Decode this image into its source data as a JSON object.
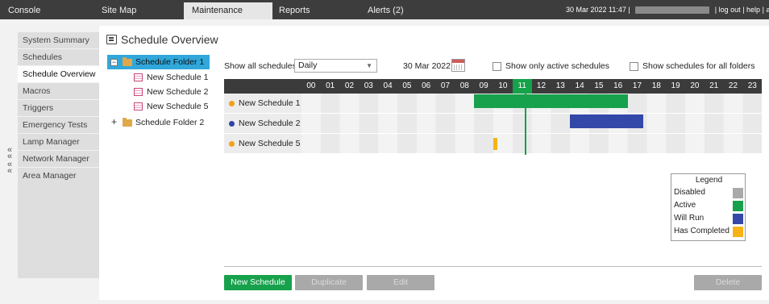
{
  "topbar": {
    "tabs": [
      {
        "label": "Console"
      },
      {
        "label": "Site Map"
      },
      {
        "label": "Maintenance"
      },
      {
        "label": "Reports"
      },
      {
        "label": "Alerts (2)"
      }
    ],
    "datetime": "30 Mar 2022 11:47",
    "links": {
      "logout": "log out",
      "help": "help",
      "about": "abou"
    },
    "sep": "|"
  },
  "sidebar": {
    "items": [
      {
        "label": "System Summary"
      },
      {
        "label": "Schedules"
      },
      {
        "label": "Schedule Overview"
      },
      {
        "label": "Macros"
      },
      {
        "label": "Triggers"
      },
      {
        "label": "Emergency Tests"
      },
      {
        "label": "Lamp Manager"
      },
      {
        "label": "Network Manager"
      },
      {
        "label": "Area Manager"
      }
    ],
    "collapse_glyph": "«"
  },
  "page": {
    "title": "Schedule Overview"
  },
  "tree": {
    "folder1": {
      "label": "Schedule Folder 1",
      "toggle": "−"
    },
    "schedules": [
      {
        "label": "New Schedule 1"
      },
      {
        "label": "New Schedule 2"
      },
      {
        "label": "New Schedule 5"
      }
    ],
    "folder2": {
      "label": "Schedule Folder 2",
      "toggle": "+"
    }
  },
  "controls": {
    "show_all_label": "Show all schedules",
    "period_value": "Daily",
    "date": "30 Mar 2022",
    "only_active_label": "Show only active schedules",
    "all_folders_label": "Show schedules for all folders"
  },
  "timeline": {
    "hours": [
      "00",
      "01",
      "02",
      "03",
      "04",
      "05",
      "06",
      "07",
      "08",
      "09",
      "10",
      "11",
      "12",
      "13",
      "14",
      "15",
      "16",
      "17",
      "18",
      "19",
      "20",
      "21",
      "22",
      "23"
    ],
    "current_hour": 11,
    "now": 11.0,
    "rows": [
      {
        "label": "New Schedule 1",
        "dot_color": "#f1a21a",
        "bars": [
          {
            "start": 9.0,
            "end": 17.0,
            "status": "active"
          }
        ]
      },
      {
        "label": "New Schedule 2",
        "dot_color": "#2e43a8",
        "bars": [
          {
            "start": 14.0,
            "end": 17.8,
            "status": "will_run"
          }
        ]
      },
      {
        "label": "New Schedule 5",
        "dot_color": "#f1a21a",
        "bars": [
          {
            "start": 10.0,
            "end": 10.2,
            "status": "completed"
          }
        ]
      }
    ]
  },
  "legend": {
    "title": "Legend",
    "items": [
      {
        "label": "Disabled",
        "color": "#a9a9a9"
      },
      {
        "label": "Active",
        "color": "#17a14c"
      },
      {
        "label": "Will Run",
        "color": "#3348a8"
      },
      {
        "label": "Has Completed",
        "color": "#f5b316"
      }
    ]
  },
  "buttons": {
    "new_schedule": "New Schedule",
    "duplicate": "Duplicate",
    "edit": "Edit",
    "delete": "Delete"
  }
}
